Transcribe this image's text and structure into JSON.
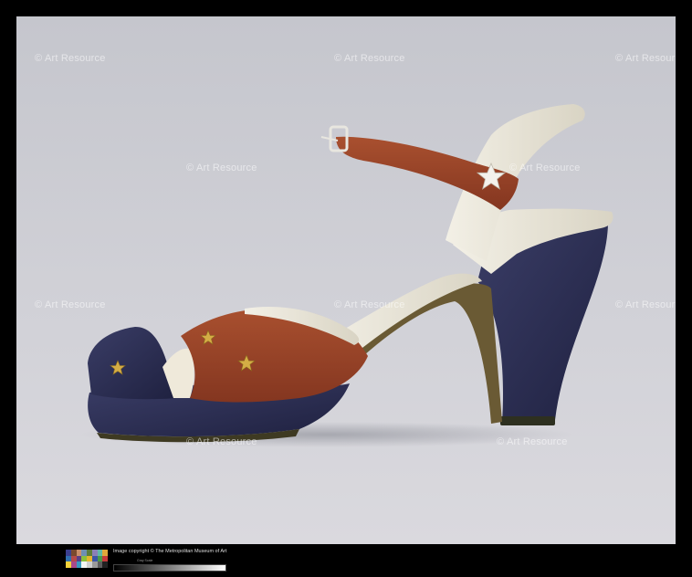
{
  "watermark": {
    "text": "© Art Resource"
  },
  "footer": {
    "copyright": "Image copyright © The Metropolitan Museum of Art",
    "gray_label": "Gray Scale",
    "swatch_colors": [
      "#3b3f8f",
      "#7a4a2e",
      "#c98f6a",
      "#6e8fb3",
      "#5c7d3c",
      "#8a7fb8",
      "#5fb6a8",
      "#e0a83a",
      "#2f6fb0",
      "#b54a4a",
      "#5a3f86",
      "#8cbf3a",
      "#e6b52c",
      "#3c56a8",
      "#4a9a4a",
      "#c63a3a",
      "#f2d23a",
      "#a84a8a",
      "#3a9ac0",
      "#f4f4f4",
      "#cfcfcf",
      "#9a9a9a",
      "#5e5e5e",
      "#222222"
    ]
  },
  "colors": {
    "background_top": "#c7c8ce",
    "background_bottom": "#d7d6dc",
    "navy": "#2b2d4f",
    "rust": "#9a4226",
    "cream": "#ece8dc",
    "gold": "#c9a33e"
  }
}
